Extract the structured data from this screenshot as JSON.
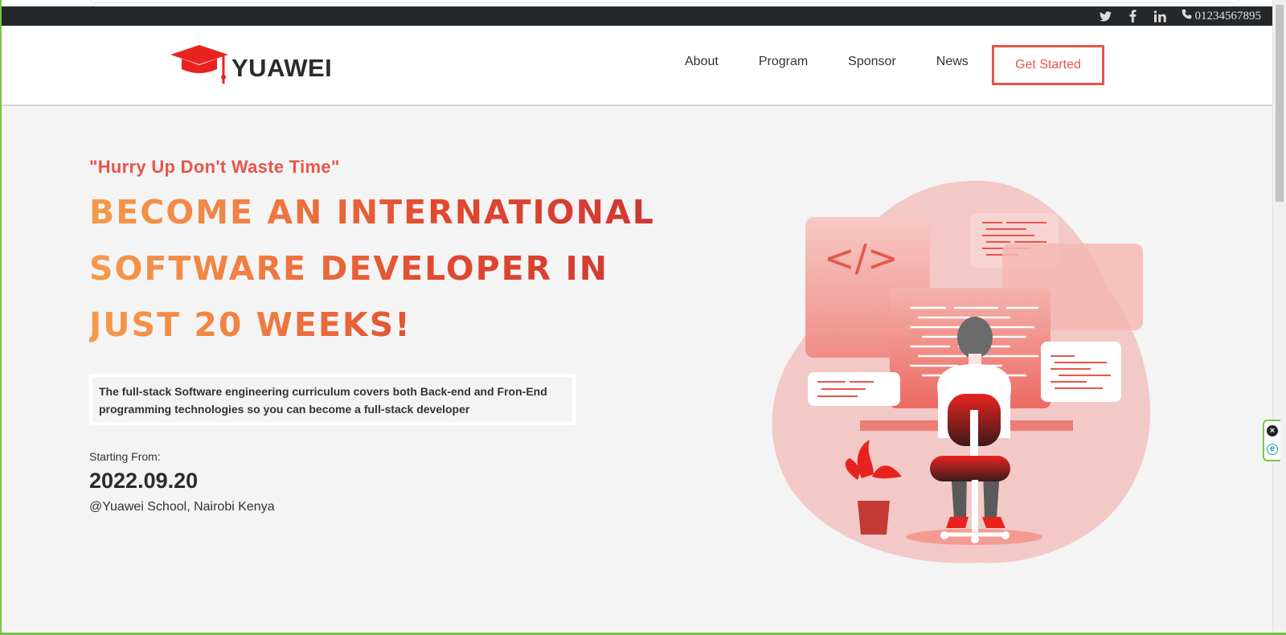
{
  "topbar": {
    "social_icons": [
      "twitter-icon",
      "facebook-icon",
      "linkedin-icon"
    ],
    "phone": "01234567895"
  },
  "header": {
    "logo_text": "YUAWEI",
    "nav": [
      "About",
      "Program",
      "Sponsor",
      "News"
    ],
    "cta": "Get Started"
  },
  "hero": {
    "tagline": "\"Hurry Up Don't Waste Time\"",
    "headline_lines": [
      "BECOME AN INTERNATIONAL",
      "SOFTWARE DEVELOPER IN",
      "JUST 20 WEEKS!"
    ],
    "description": "The full-stack Software engineering curriculum covers both Back-end and Fron-End programming technologies so you can become a full-stack developer",
    "start_label": "Starting From:",
    "start_date": "2022.09.20",
    "location": "@Yuawei School, Nairobi Kenya",
    "code_symbol": "</>"
  },
  "colors": {
    "accent": "#e8554b",
    "topbar_bg": "#25282b",
    "page_bg": "#f4f4f4",
    "frame_border": "#7cc242"
  }
}
